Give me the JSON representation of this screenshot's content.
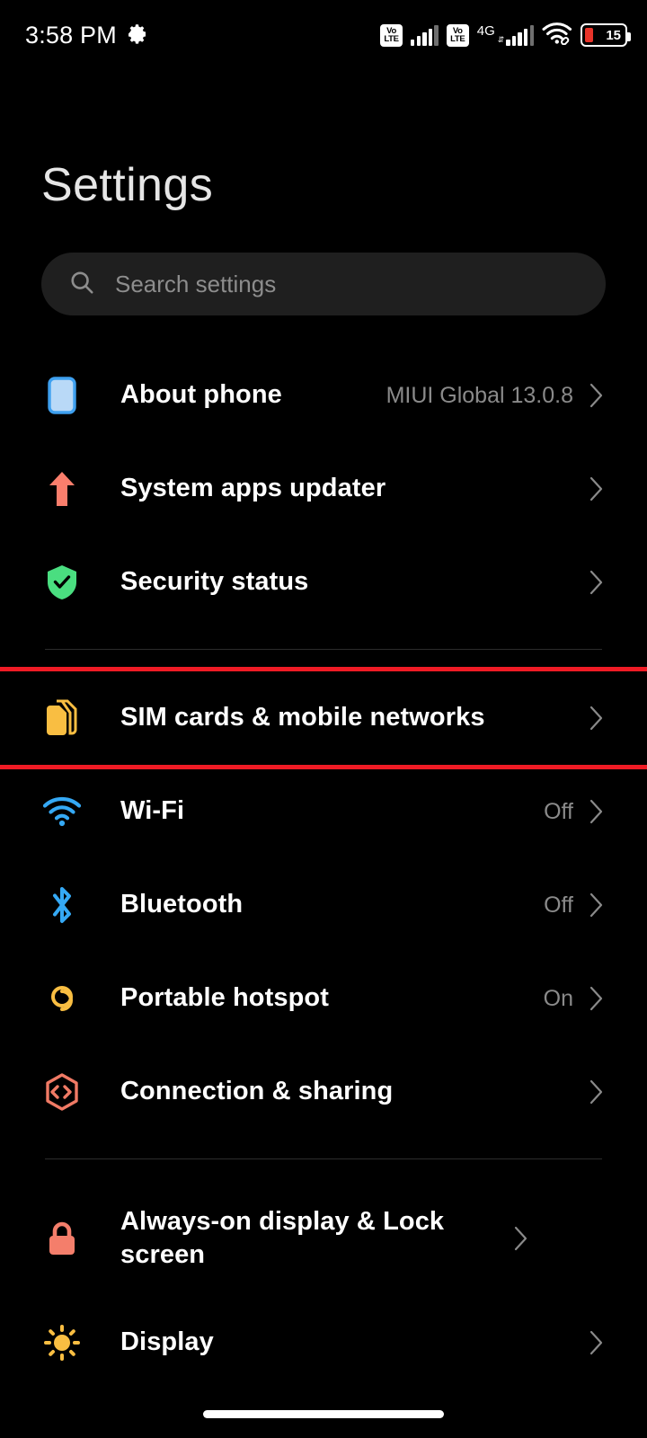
{
  "statusbar": {
    "time": "3:58 PM",
    "gear_icon": "gear-icon",
    "volte1": {
      "top": "Vo",
      "bottom": "LTE"
    },
    "volte2": {
      "top": "Vo",
      "bottom": "LTE"
    },
    "network_type": "4G",
    "wifi_icon": "wifi-link-icon",
    "battery_percent": "15",
    "battery_color": "#e8342a"
  },
  "header": {
    "title": "Settings"
  },
  "search": {
    "placeholder": "Search settings",
    "value": "",
    "icon": "search-icon"
  },
  "groups": [
    {
      "items": [
        {
          "label": "About phone",
          "value": "MIUI Global 13.0.8",
          "icon": "phone-icon",
          "icon_color": "#9ecbf5",
          "highlight": false
        },
        {
          "label": "System apps updater",
          "value": "",
          "icon": "arrow-up-icon",
          "icon_color": "#fa7e6c",
          "highlight": false
        },
        {
          "label": "Security status",
          "value": "",
          "icon": "shield-check-icon",
          "icon_color": "#4ade80",
          "highlight": false
        }
      ]
    },
    {
      "items": [
        {
          "label": "SIM cards & mobile networks",
          "value": "",
          "icon": "sim-card-icon",
          "icon_color": "#f9be42",
          "highlight": true
        },
        {
          "label": "Wi-Fi",
          "value": "Off",
          "icon": "wifi-icon",
          "icon_color": "#35a9f5",
          "highlight": false
        },
        {
          "label": "Bluetooth",
          "value": "Off",
          "icon": "bluetooth-icon",
          "icon_color": "#35a9f5",
          "highlight": false
        },
        {
          "label": "Portable hotspot",
          "value": "On",
          "icon": "hotspot-icon",
          "icon_color": "#f9be42",
          "highlight": false
        },
        {
          "label": "Connection & sharing",
          "value": "",
          "icon": "connection-sharing-icon",
          "icon_color": "#f07a65",
          "highlight": false
        }
      ]
    },
    {
      "items": [
        {
          "label": "Always-on display & Lock screen",
          "value": "",
          "icon": "lock-icon",
          "icon_color": "#f47e6b",
          "highlight": false
        },
        {
          "label": "Display",
          "value": "",
          "icon": "brightness-icon",
          "icon_color": "#f9be42",
          "highlight": false
        }
      ]
    }
  ],
  "highlight_color": "#ef1b25",
  "chevron_icon": "chevron-right-icon"
}
